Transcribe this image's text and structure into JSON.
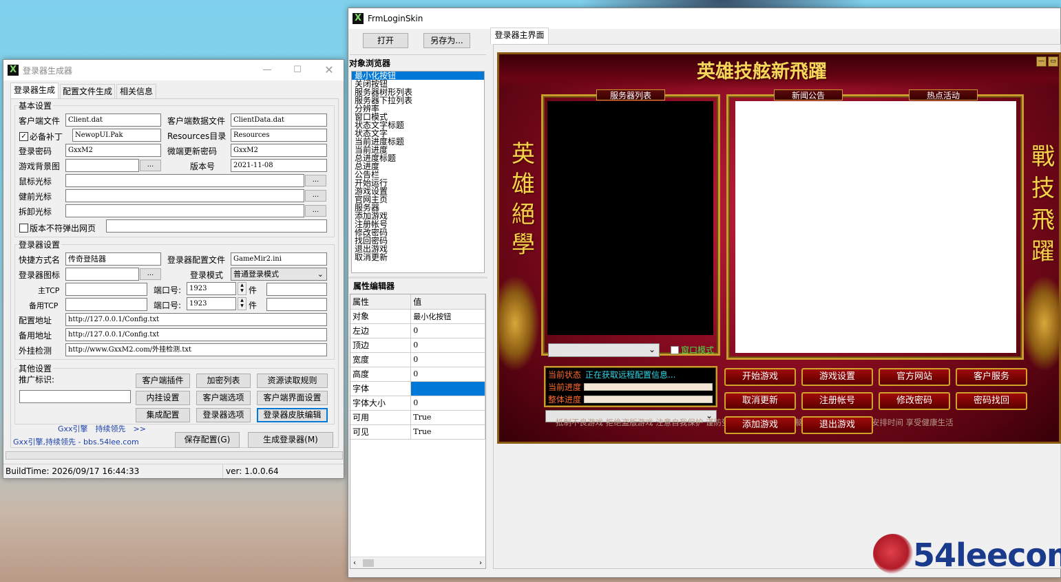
{
  "gen": {
    "title": "登录器生成器",
    "tabs": [
      "登录器生成",
      "配置文件生成",
      "相关信息"
    ],
    "basic": {
      "title": "基本设置",
      "client_file_lbl": "客户端文件",
      "client_file": "Client.dat",
      "client_data_lbl": "客户端数据文件",
      "client_data": "ClientData.dat",
      "patch_lbl": "必备补丁",
      "patch": "NewopUI.Pak",
      "res_lbl": "Resources目录",
      "res": "Resources",
      "pwd_lbl": "登录密码",
      "pwd": "GxxM2",
      "update_pwd_lbl": "微端更新密码",
      "update_pwd": "GxxM2",
      "bg_lbl": "游戏背景图",
      "bg": "",
      "ver_lbl": "版本号",
      "ver": "2021-11-08",
      "cursor_lbl": "鼠标光标",
      "prev_cursor_lbl": "健前光标",
      "unload_cursor_lbl": "拆卸光标",
      "mismatch_lbl": "版本不符弹出网页",
      "dots": "..."
    },
    "login": {
      "title": "登录器设置",
      "shortcut_lbl": "快捷方式名",
      "shortcut": "传奇登陆器",
      "cfg_file_lbl": "登录器配置文件",
      "cfg_file": "GameMir2.ini",
      "icon_lbl": "登录器图标",
      "mode_lbl": "登录模式",
      "mode": "普通登录模式",
      "main_tcp_lbl": "主TCP",
      "port_lbl": "端口号:",
      "port1": "1923",
      "unit": "件",
      "backup_tcp_lbl": "备用TCP",
      "port2": "1923",
      "cfg_addr_lbl": "配置地址",
      "cfg_addr": "http://127.0.0.1/Config.txt",
      "backup_addr_lbl": "备用地址",
      "backup_addr": "http://127.0.0.1/Config.txt",
      "plugin_lbl": "外挂检测",
      "plugin": "http://www.GxxM2.com/外挂检测.txt"
    },
    "other": {
      "title": "其他设置",
      "promo_lbl": "推广标识:",
      "buttons": [
        "客户端插件",
        "加密列表",
        "资源读取规则",
        "内挂设置",
        "客户端选项",
        "客户端界面设置",
        "集成配置",
        "登录器选项",
        "登录器皮肤编辑"
      ]
    },
    "footer": {
      "link1": "Gxx引擎　持续领先　>>",
      "link2": "Gxx引擎,持续领先 - bbs.54lee.com",
      "save": "保存配置(G)",
      "gen": "生成登录器(M)"
    },
    "status": {
      "build": "BuildTime:  2026/09/17 16:44:33",
      "ver": "ver:  1.0.0.64"
    }
  },
  "skin": {
    "title": "FrmLoginSkin",
    "open": "打开",
    "saveas": "另存为...",
    "tab": "登录器主界面",
    "browser_title": "对象浏览器",
    "objects": [
      "最小化按钮",
      "关闭按钮",
      "服务器树形列表",
      "服务器下拉列表",
      "分辨率",
      "窗口模式",
      "状态文字标题",
      "状态文字",
      "当前进度标题",
      "当前进度",
      "总进度标题",
      "总进度",
      "公告栏",
      "开始运行",
      "游戏设置",
      "官网主页",
      "服务器",
      "添加游戏",
      "注册帐号",
      "修改密码",
      "找回密码",
      "退出游戏",
      "取消更新"
    ],
    "prop_title": "属性编辑器",
    "prop_head": [
      "属性",
      "值"
    ],
    "props": [
      [
        "对象",
        "最小化按钮"
      ],
      [
        "左边",
        "0"
      ],
      [
        "顶边",
        "0"
      ],
      [
        "宽度",
        "0"
      ],
      [
        "高度",
        "0"
      ],
      [
        "字体",
        ""
      ],
      [
        "字体大小",
        "0"
      ],
      [
        "可用",
        "True"
      ],
      [
        "可见",
        "True"
      ]
    ]
  },
  "game": {
    "title": "英雄技舷新飛躍",
    "left": [
      "英",
      "雄",
      "絕",
      "學"
    ],
    "right": [
      "戰",
      "技",
      "飛",
      "躍"
    ],
    "server_list": "服务器列表",
    "news": "新闻公告",
    "hot": "热点活动",
    "window_mode": "窗口模式",
    "state_lbl": "当前状态",
    "state": "正在获取远程配置信息...",
    "cur_lbl": "当前进度",
    "total_lbl": "整体进度",
    "buttons": [
      "开始游戏",
      "游戏设置",
      "官方网站",
      "客户服务",
      "取消更新",
      "注册帐号",
      "修改密码",
      "密码找回",
      "添加游戏",
      "退出游戏"
    ],
    "health": "抵制不良游戏 拒绝盗版游戏 注意自我保护 谨防受骗上当 适度游戏益脑 沉迷游戏伤身 合理安排时间 享受健康生活"
  },
  "watermark": "54leecom"
}
